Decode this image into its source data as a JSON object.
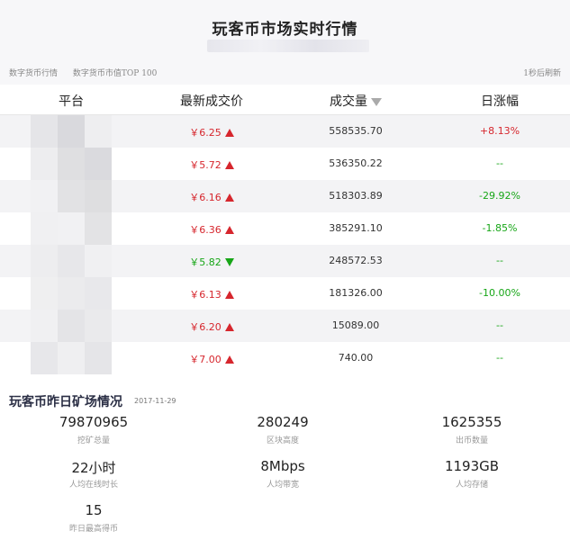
{
  "header": {
    "title": "玩客币市场实时行情",
    "nav": [
      "数字货币行情",
      "数字货币市值TOP 100"
    ],
    "refresh": "1秒后刷新"
  },
  "table": {
    "columns": [
      "平台",
      "最新成交价",
      "成交量",
      "日涨幅"
    ],
    "rows": [
      {
        "price": "￥6.25",
        "direction": "up",
        "volume": "558535.70",
        "change": "+8.13%",
        "change_type": "pos"
      },
      {
        "price": "￥5.72",
        "direction": "up",
        "volume": "536350.22",
        "change": "--",
        "change_type": "flat"
      },
      {
        "price": "￥6.16",
        "direction": "up",
        "volume": "518303.89",
        "change": "-29.92%",
        "change_type": "neg"
      },
      {
        "price": "￥6.36",
        "direction": "up",
        "volume": "385291.10",
        "change": "-1.85%",
        "change_type": "neg"
      },
      {
        "price": "￥5.82",
        "direction": "down",
        "volume": "248572.53",
        "change": "--",
        "change_type": "flat"
      },
      {
        "price": "￥6.13",
        "direction": "up",
        "volume": "181326.00",
        "change": "-10.00%",
        "change_type": "neg"
      },
      {
        "price": "￥6.20",
        "direction": "up",
        "volume": "15089.00",
        "change": "--",
        "change_type": "flat"
      },
      {
        "price": "￥7.00",
        "direction": "up",
        "volume": "740.00",
        "change": "--",
        "change_type": "flat"
      }
    ]
  },
  "mining": {
    "title": "玩客币昨日矿场情况",
    "date": "2017-11-29",
    "stats": [
      {
        "value": "79870965",
        "label": "挖矿总量"
      },
      {
        "value": "280249",
        "label": "区块高度"
      },
      {
        "value": "1625355",
        "label": "出币数量"
      },
      {
        "value": "22小时",
        "label": "人均在线时长"
      },
      {
        "value": "8Mbps",
        "label": "人均带宽"
      },
      {
        "value": "1193GB",
        "label": "人均存储"
      },
      {
        "value": "15",
        "label": "昨日最高得币"
      }
    ]
  },
  "colors": {
    "up": "#d6262d",
    "down": "#17a617",
    "header_bg": "#f7f7f9",
    "row_alt_bg": "#f3f3f5"
  }
}
